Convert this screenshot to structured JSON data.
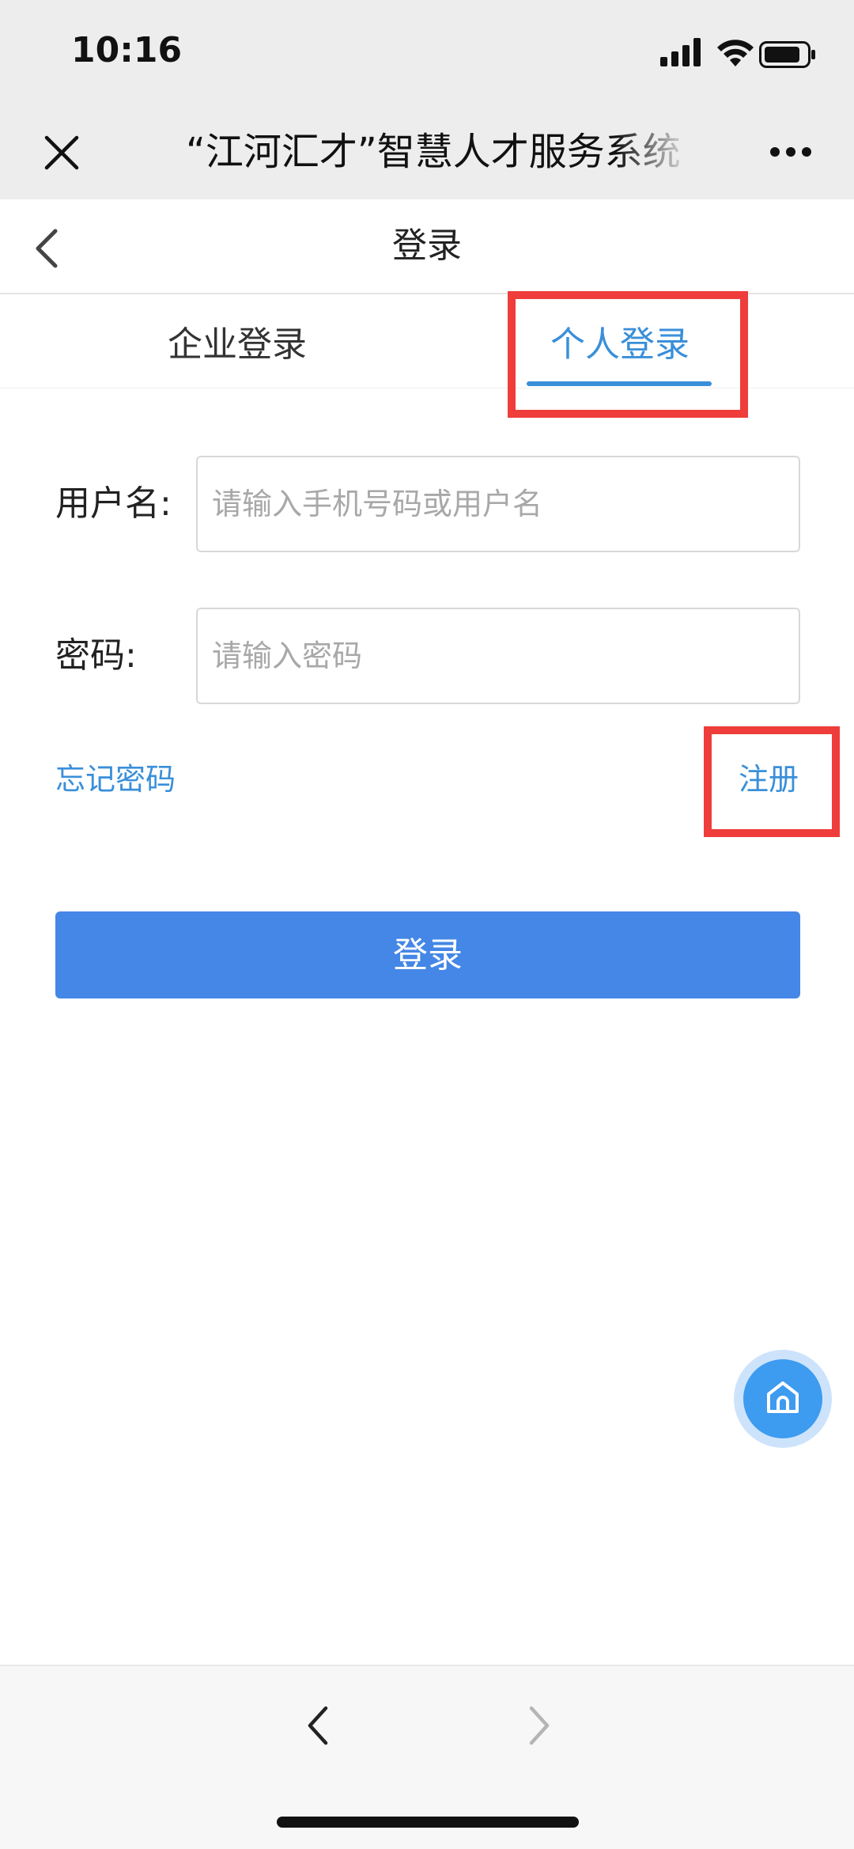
{
  "status_bar": {
    "time": "10:16"
  },
  "wechat_header": {
    "title": "“江河汇才”智慧人才服务系统",
    "close_icon": "close-icon",
    "more_icon": "more-icon"
  },
  "page": {
    "title": "登录",
    "back_icon": "chevron-left-icon"
  },
  "tabs": [
    {
      "label": "企业登录",
      "active": false
    },
    {
      "label": "个人登录",
      "active": true
    }
  ],
  "form": {
    "username": {
      "label": "用户名:",
      "placeholder": "请输入手机号码或用户名",
      "value": ""
    },
    "password": {
      "label": "密码:",
      "placeholder": "请输入密码",
      "value": ""
    },
    "forgot_link": "忘记密码",
    "register_link": "注册",
    "login_button": "登录"
  },
  "floating": {
    "home_icon": "home-icon"
  },
  "colors": {
    "accent": "#3a8fd9",
    "button": "#4487e6",
    "highlight": "#ee3d3a"
  }
}
